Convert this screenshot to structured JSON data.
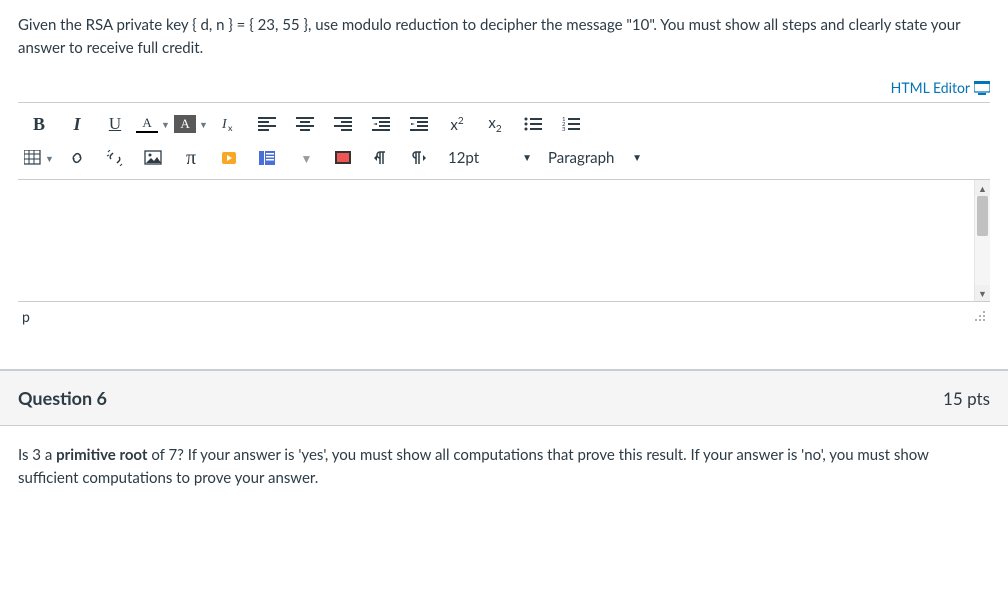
{
  "question5": {
    "text": "Given the RSA private key { d, n } = { 23, 55 }, use modulo reduction to decipher the message \"10\". You must show all steps and clearly state your answer to receive full credit."
  },
  "editor": {
    "html_editor_link": "HTML Editor",
    "font_size": "12pt",
    "block_format": "Paragraph",
    "path": "p",
    "content": ""
  },
  "toolbar": {
    "bold": "B",
    "italic": "I",
    "underline": "U",
    "textcolor": "A",
    "bgcolor": "A",
    "clearformat": "clear",
    "alignleft": "align-left",
    "aligncenter": "align-center",
    "alignright": "align-right",
    "outdent": "outdent",
    "indent": "indent",
    "superscript": "x²",
    "subscript": "x₂",
    "bullets": "ul",
    "numbers": "ol",
    "table": "table",
    "link": "link",
    "unlink": "unlink",
    "image": "image",
    "equation": "π",
    "record": "record",
    "embed": "embed",
    "insert": "insert",
    "fullscreen": "fullscreen",
    "ltr": "ltr",
    "rtl": "rtl"
  },
  "question6": {
    "title": "Question 6",
    "points": "15 pts",
    "text_before_bold": "Is 3 a ",
    "text_bold": "primitive root",
    "text_after_bold": " of 7? If your answer is 'yes', you must show all computations that prove this result. If your answer is 'no', you must show sufficient computations to prove your answer."
  }
}
